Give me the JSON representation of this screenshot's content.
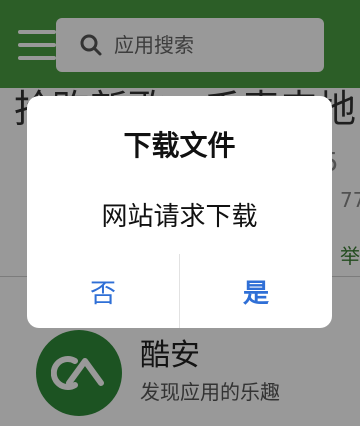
{
  "header": {
    "search_placeholder": "应用搜索"
  },
  "background": {
    "headline": "抢购新歌，千表来地",
    "side_1": "5",
    "side_2": "77",
    "side_3": "举",
    "app": {
      "name": "酷安",
      "description": "发现应用的乐趣"
    }
  },
  "dialog": {
    "title": "下载文件",
    "message": "网站请求下载",
    "cancel_label": "否",
    "confirm_label": "是"
  },
  "colors": {
    "topbar": "#4a9d41",
    "app_logo": "#2f8a3a",
    "button_text": "#2f6fd6"
  }
}
